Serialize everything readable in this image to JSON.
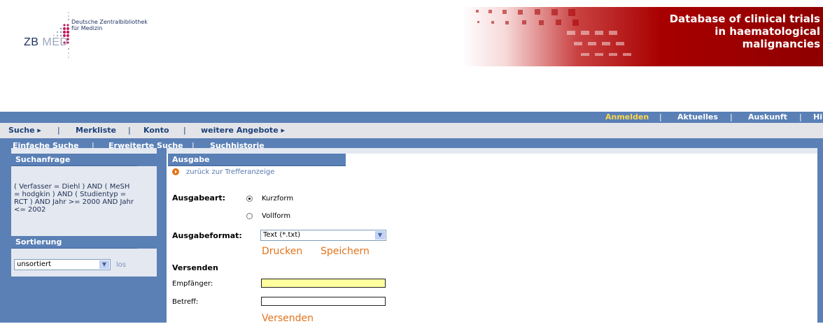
{
  "header": {
    "institution_line1": "Deutsche Zentralbibliothek",
    "institution_line2": "für Medizin",
    "logo_left": "ZB ",
    "logo_right": "MED",
    "banner_title_line1": "Database of clinical trials",
    "banner_title_line2": "in haematological",
    "banner_title_line3": "malignancies"
  },
  "top_nav": {
    "anmelden": "Anmelden",
    "aktuelles": "Aktuelles",
    "auskunft": "Auskunft",
    "hilfe": "Hi",
    "sep": "|"
  },
  "main_nav": {
    "suche": "Suche ▸",
    "merkliste": "Merkliste",
    "konto": "Konto",
    "weitere": "weitere Angebote ▸",
    "sep": "|"
  },
  "sub_nav": {
    "einfache": "Einfache Suche",
    "erweiterte": "Erweiterte Suche",
    "historie": "Suchhistorie",
    "sep": "|"
  },
  "left_panel": {
    "suchanfrage_title": "Suchanfrage",
    "query": "( Verfasser = Diehl ) AND ( MeSH\n= hodgkin ) AND ( Studientyp =\nRCT ) AND Jahr >= 2000 AND Jahr\n<= 2002",
    "sortierung_title": "Sortierung",
    "sort_value": "unsortiert",
    "los": "los"
  },
  "main": {
    "ausgabe_title": "Ausgabe",
    "back_link": "zurück zur Trefferanzeige",
    "ausgabeart_label": "Ausgabeart:",
    "radio_kurz": "Kurzform",
    "radio_voll": "Vollform",
    "ausgabeformat_label": "Ausgabeformat:",
    "format_value": "Text (*.txt)",
    "drucken": "Drucken",
    "speichern": "Speichern",
    "versenden_heading": "Versenden",
    "empfaenger_label": "Empfänger:",
    "betreff_label": "Betreff:",
    "versenden_button": "Versenden",
    "empfaenger_value": "",
    "betreff_value": ""
  },
  "colors": {
    "nav_blue": "#5a80b6",
    "accent_orange": "#e2731a",
    "banner_red": "#a80000",
    "active_yellow": "#ffd84a"
  }
}
